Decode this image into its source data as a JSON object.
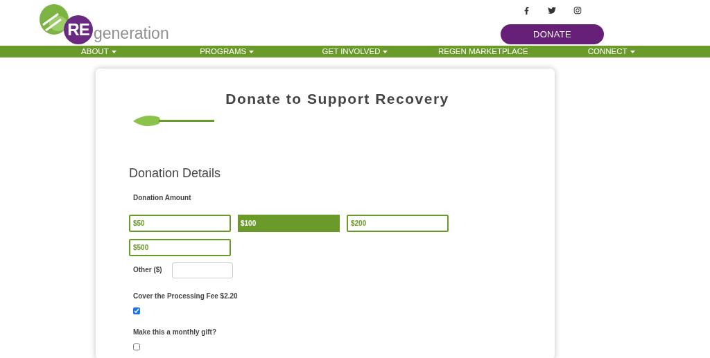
{
  "logo": {
    "mark": "RE",
    "word": "generation"
  },
  "donate_button": "DONATE",
  "nav": [
    {
      "label": "ABOUT",
      "has_menu": true
    },
    {
      "label": "PROGRAMS",
      "has_menu": true
    },
    {
      "label": "GET INVOLVED",
      "has_menu": true
    },
    {
      "label": "REGEN MARKETPLACE",
      "has_menu": false
    },
    {
      "label": "CONNECT",
      "has_menu": true
    }
  ],
  "form": {
    "title": "Donate to Support Recovery",
    "section": "Donation Details",
    "amount_label": "Donation Amount",
    "amounts": [
      {
        "label": "$50",
        "selected": false
      },
      {
        "label": "$100",
        "selected": true
      },
      {
        "label": "$200",
        "selected": false
      },
      {
        "label": "$500",
        "selected": false
      }
    ],
    "other_label": "Other ($)",
    "options": [
      {
        "label": "Cover the Processing Fee $2.20",
        "checked": true
      },
      {
        "label": "Make this a monthly gift?",
        "checked": false
      }
    ]
  }
}
